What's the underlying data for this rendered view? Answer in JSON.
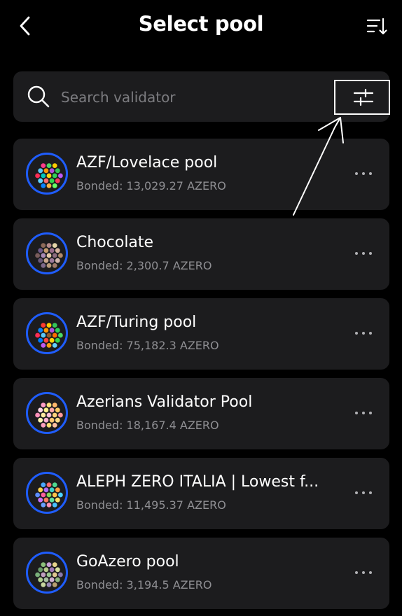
{
  "header": {
    "title": "Select pool"
  },
  "search": {
    "placeholder": "Search validator"
  },
  "pools": [
    {
      "name": "AZF/Lovelace pool",
      "bonded_label": "Bonded:",
      "bonded_value": "13,029.27 AZERO",
      "colors": [
        "#ff3b8a",
        "#4cd964",
        "#ffcc00",
        "#5ac8fa",
        "#ff9500",
        "#af52de",
        "#34c759",
        "#ff2d55",
        "#00c7be",
        "#ffd60a",
        "#30d158",
        "#bf5af2",
        "#64d2ff",
        "#ff6b6b",
        "#32d74b",
        "#ff375f",
        "#0a84ff",
        "#ffb340",
        "#66ff66"
      ]
    },
    {
      "name": "Chocolate",
      "bonded_label": "Bonded:",
      "bonded_value": "2,300.7 AZERO",
      "colors": [
        "#8e6a5a",
        "#b58a8a",
        "#e6d6a8",
        "#6e5a8a",
        "#c49a6c",
        "#9a6d8c",
        "#d8b4a0",
        "#7a5c5c",
        "#a98ab5",
        "#e3c7a5",
        "#8c6a7e",
        "#b08a6a",
        "#6a5a7a",
        "#c9a68a",
        "#9e7a9a",
        "#d4b8b0",
        "#7e6a8a",
        "#b89a7a",
        "#a07a6a"
      ]
    },
    {
      "name": "AZF/Turing pool",
      "bonded_label": "Bonded:",
      "bonded_value": "75,182.3 AZERO",
      "colors": [
        "#ff3b30",
        "#ffcc00",
        "#34c759",
        "#0a84ff",
        "#ff9500",
        "#af52de",
        "#30d158",
        "#ff2d55",
        "#5ac8fa",
        "#8e5a2a",
        "#ff6b00",
        "#4cd964",
        "#007aff",
        "#ff453a",
        "#ffd60a",
        "#32d74b",
        "#bf5af2",
        "#ff9f0a",
        "#64d2ff"
      ]
    },
    {
      "name": "Azerians Validator Pool",
      "bonded_label": "Bonded:",
      "bonded_value": "18,167.4 AZERO",
      "colors": [
        "#ff9ec7",
        "#ffe27a",
        "#ffb86b",
        "#ffd6e8",
        "#fff08a",
        "#ffa8a8",
        "#ffcc66",
        "#ff8fb8",
        "#ffe9a0",
        "#ffbfd9",
        "#ffd27a",
        "#ff9a9a",
        "#fff3b0",
        "#ffb0d0",
        "#ffc870",
        "#ffdd88",
        "#ffa0c0",
        "#ffe070",
        "#ffc0a0"
      ]
    },
    {
      "name": "ALEPH ZERO ITALIA | Lowest f...",
      "bonded_label": "Bonded:",
      "bonded_value": "11,495.37 AZERO",
      "colors": [
        "#4aa8ff",
        "#ff6b6b",
        "#50d890",
        "#ffd24a",
        "#b06bff",
        "#3fd0c9",
        "#ff9f43",
        "#5b8cff",
        "#ff5e9c",
        "#7ed957",
        "#ffc14a",
        "#4dd2ff",
        "#c774ff",
        "#ff7a5c",
        "#5fe0a0",
        "#ffe066",
        "#6aa0ff",
        "#ff8fb1",
        "#48c0ff"
      ]
    },
    {
      "name": "GoAzero pool",
      "bonded_label": "Bonded:",
      "bonded_value": "3,194.5 AZERO",
      "colors": [
        "#8bbf7a",
        "#c9a0d8",
        "#e6d38a",
        "#6a9a6a",
        "#b5c98a",
        "#a07ab8",
        "#d8e0a0",
        "#7ab07a",
        "#c0a0c0",
        "#9ac890",
        "#e0c890",
        "#8a7aa8",
        "#b0d090",
        "#a8c0a0",
        "#d0b0d0",
        "#90b880",
        "#c8d8a0",
        "#9a8ab8",
        "#b8a070"
      ]
    }
  ]
}
